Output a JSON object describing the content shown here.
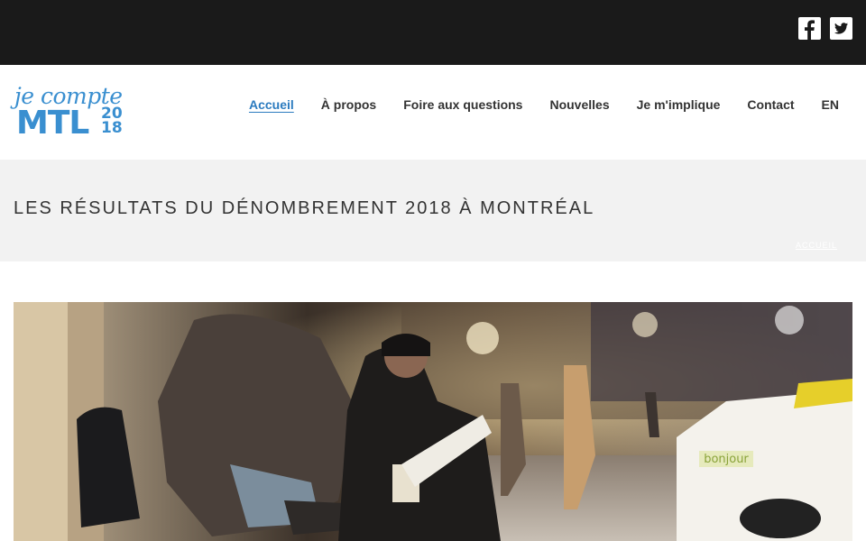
{
  "social": {
    "facebook_icon": "facebook-icon",
    "twitter_icon": "twitter-icon"
  },
  "logo": {
    "script": "je compte",
    "mtl": "MTL",
    "year_top": "20",
    "year_bottom": "18"
  },
  "nav": {
    "items": [
      {
        "label": "Accueil",
        "active": true
      },
      {
        "label": "À propos"
      },
      {
        "label": "Foire aux questions"
      },
      {
        "label": "Nouvelles"
      },
      {
        "label": "Je m'implique"
      },
      {
        "label": "Contact"
      },
      {
        "label": "EN"
      }
    ]
  },
  "title": "LES RÉSULTATS DU DÉNOMBREMENT 2018 À MONTRÉAL",
  "breadcrumb": "ACCUEIL",
  "hero": {
    "taxi_sign": "bonjour"
  },
  "colors": {
    "topbar": "#1a1a1a",
    "accent": "#2b7bbf",
    "titlebar": "#f2f2f2"
  }
}
